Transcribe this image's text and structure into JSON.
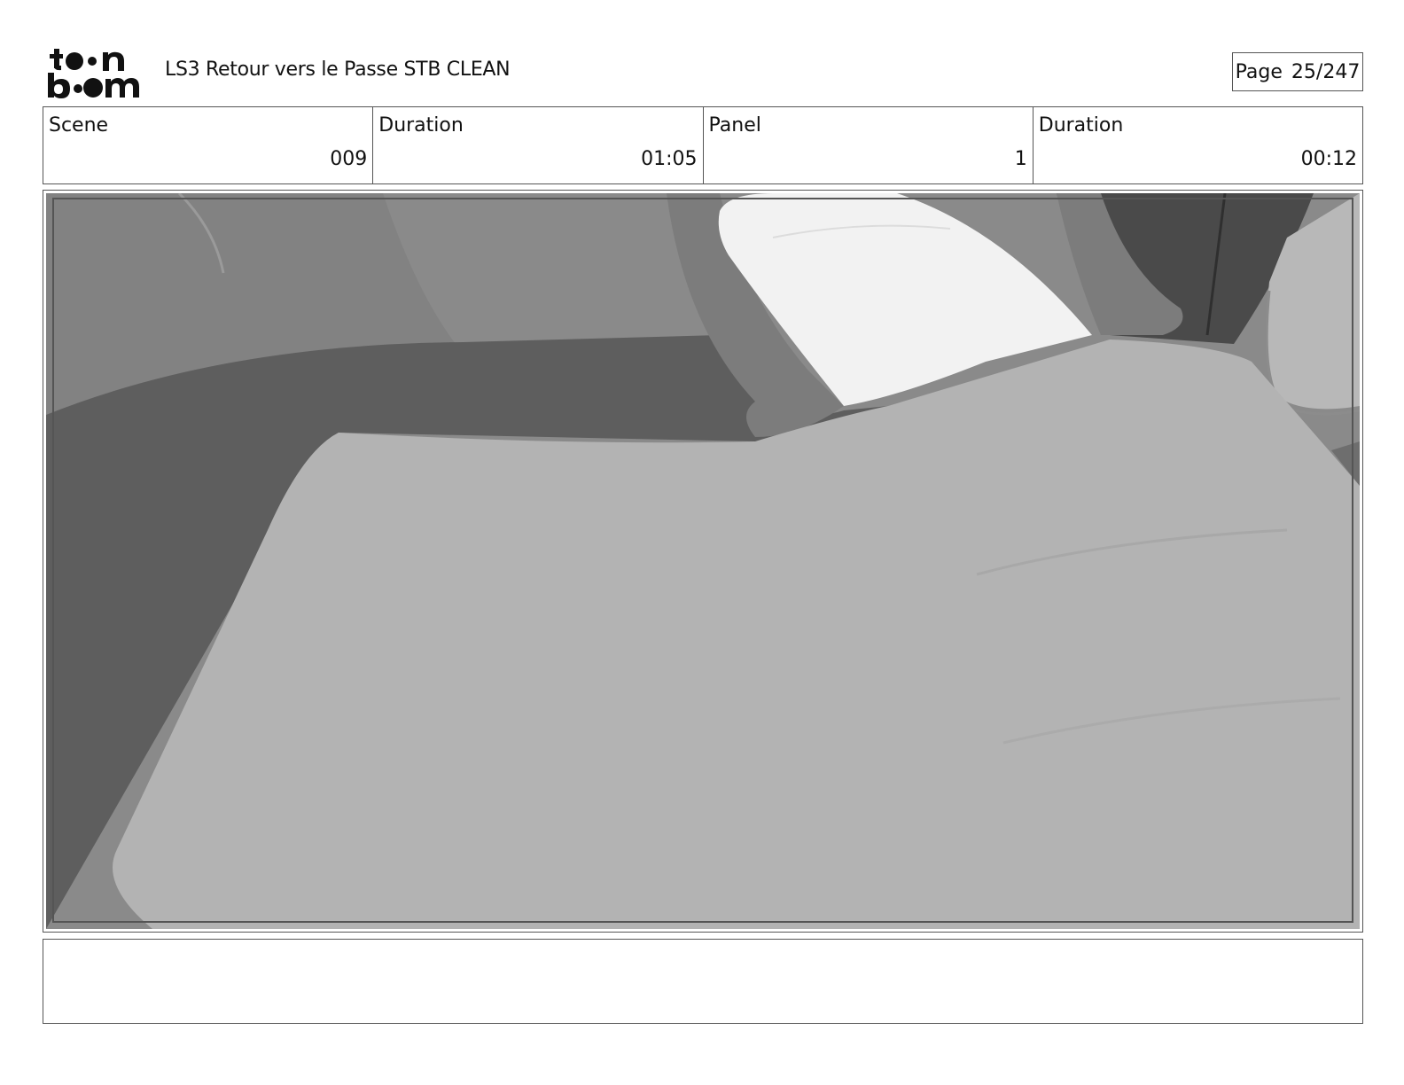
{
  "header": {
    "logo_text": "toonboom",
    "document_title": "LS3 Retour vers le Passe STB CLEAN",
    "page_label": "Page",
    "page_value": "25/247"
  },
  "info": {
    "scene_label": "Scene",
    "scene_value": "009",
    "scene_duration_label": "Duration",
    "scene_duration_value": "01:05",
    "panel_label": "Panel",
    "panel_value": "1",
    "panel_duration_label": "Duration",
    "panel_duration_value": "00:12"
  },
  "panel": {
    "image_description_icon": "storyboard-panel-image"
  },
  "notes": {
    "text": ""
  }
}
